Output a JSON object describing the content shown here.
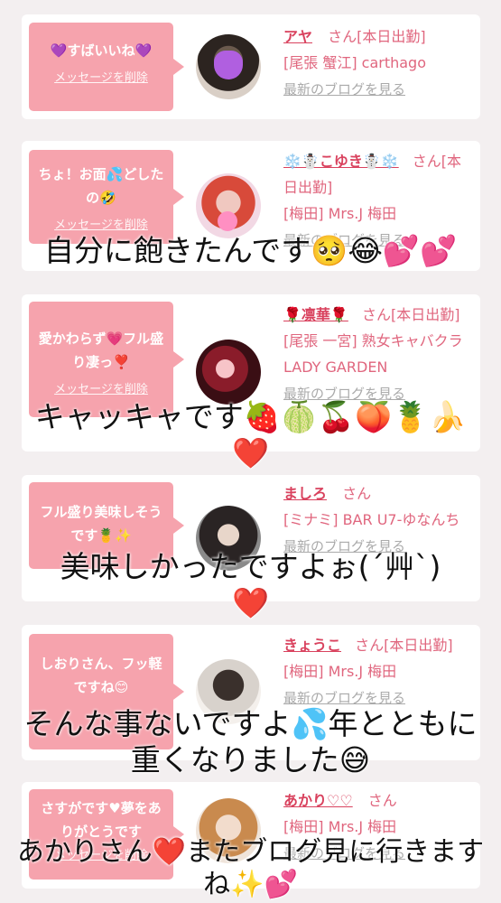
{
  "colors": {
    "background": "#f3eff0",
    "bubble": "#f6a3ad",
    "name": "#d9425e",
    "link": "#aaaaaa"
  },
  "cards": [
    {
      "message": "💜すばいいね💜",
      "delete": "メッセージを削除",
      "name": "アヤ",
      "san": "さん[本日出勤]",
      "shop": "[尾張 蟹江] carthago",
      "blog": "最新のブログを見る"
    },
    {
      "message": "ちょ！お面💦どしたの🤣",
      "delete": "メッセージを削除",
      "name": "❄️☃️こゆき☃️❄️",
      "san": "さん[本日出勤]",
      "shop": "[梅田] Mrs.J 梅田",
      "blog": "最新のブログを見る"
    },
    {
      "message": "愛かわらず💗フル盛り凄っ❣️",
      "delete": "メッセージを削除",
      "name": "🌹凛華🌹",
      "san": "さん[本日出勤]",
      "shop": "[尾張 一宮] 熟女キャバクラ LADY GARDEN",
      "blog": "最新のブログを見る"
    },
    {
      "message": "フル盛り美味しそうです🍍✨",
      "delete": "メッセージを削除",
      "name": "ましろ",
      "san": "さん",
      "shop": "[ミナミ] BAR U7-ゆなんち",
      "blog": "最新のブログを見る"
    },
    {
      "message": "しおりさん、フッ軽ですね😊",
      "delete": "メッセージを削除",
      "name": "きょうこ",
      "san": "さん[本日出勤]",
      "shop": "[梅田] Mrs.J 梅田",
      "blog": "最新のブログを見る"
    },
    {
      "message": "さすがです♥夢をありがとうです",
      "delete": "メッセージを削除",
      "name": "あかり♡♡",
      "san": "さん",
      "shop": "[梅田] Mrs.J 梅田",
      "blog": "最新のブログを見る"
    }
  ],
  "overlays": [
    "自分に飽きたんです🥺😂💕💕",
    "キャッキャです🍓🍈🍒🍑🍍🍌❤️",
    "美味しかったですよぉ(´艸`)❤️",
    "そんな事ないですよ💦年とともに重くなりました😅",
    "あかりさん❤️またブログ見に行きますね✨💕"
  ]
}
